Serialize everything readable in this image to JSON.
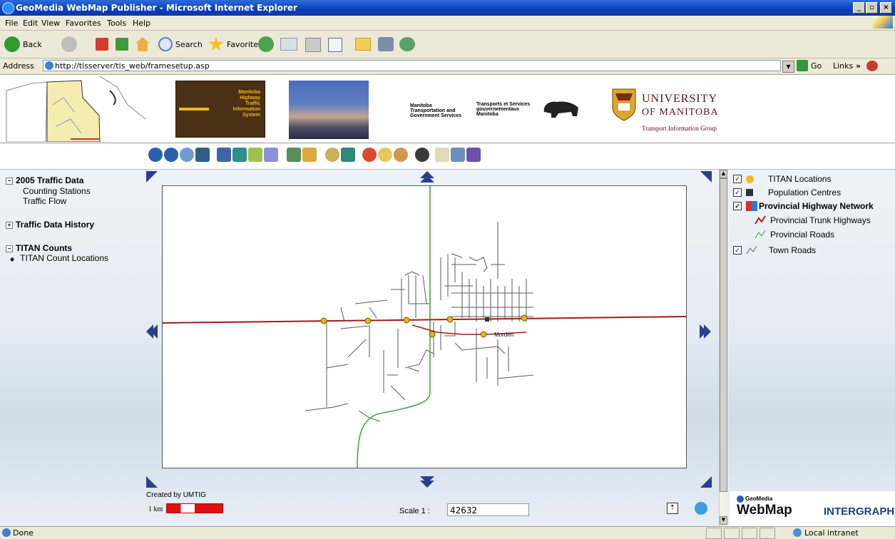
{
  "window": {
    "title": "GeoMedia WebMap Publisher - Microsoft Internet Explorer",
    "minimize": "_",
    "restore": "▫",
    "close": "×"
  },
  "menu": [
    "File",
    "Edit",
    "View",
    "Favorites",
    "Tools",
    "Help"
  ],
  "toolbar": {
    "back": "Back",
    "search": "Search",
    "favorites": "Favorites"
  },
  "address": {
    "label": "Address",
    "url": "http://tisserver/tis_web/framesetup.asp",
    "go": "Go",
    "links": "Links"
  },
  "banner": {
    "mhtis": [
      "Manitoba",
      "Highway",
      "Traffic",
      "Information",
      "System"
    ],
    "gov_en": [
      "Manitoba",
      "Transportation and",
      "Government Services"
    ],
    "gov_fr": [
      "Transports et Services",
      "gouvernementaux",
      "Manitoba"
    ],
    "university_line1": "UNIVERSITY",
    "university_line2": "OF MANITOBA",
    "university_group": "Transport Information Group"
  },
  "sidebar": {
    "sections": [
      {
        "title": "2005 Traffic Data",
        "expander": "⊟",
        "items": [
          "Counting Stations",
          "Traffic Flow"
        ]
      },
      {
        "title": "Traffic Data History",
        "expander": "⊞",
        "items": []
      },
      {
        "title": "TITAN Counts",
        "expander": "⊟",
        "items": [
          "TITAN Count Locations"
        ]
      }
    ]
  },
  "map": {
    "town_label": "Morden",
    "credit": "Created by UMTIG",
    "scalebar_label": "1 km",
    "scale_label": "Scale  1 :",
    "scale_value": "42632"
  },
  "legend": {
    "items": [
      {
        "label": "TITAN Locations",
        "checked": true
      },
      {
        "label": "Population Centres",
        "checked": true
      },
      {
        "label": "Provincial Highway Network",
        "checked": true,
        "bold": true
      },
      {
        "label": "Provincial Trunk Highways"
      },
      {
        "label": "Provincial Roads"
      },
      {
        "label": "Town Roads",
        "checked": true
      }
    ],
    "checkmark": "✓"
  },
  "logos": {
    "geomedia_small": "GeoMedia",
    "webmap": "WebMap",
    "intergraph": "INTERGRAPH"
  },
  "status": {
    "left": "Done",
    "right": "Local intranet"
  },
  "colors": {
    "trunk_highway": "#a31b1b",
    "provincial_road": "#3aa33a",
    "titan": "#e3b418",
    "town_road": "#555555",
    "title_blue": "#0a3fb5"
  }
}
